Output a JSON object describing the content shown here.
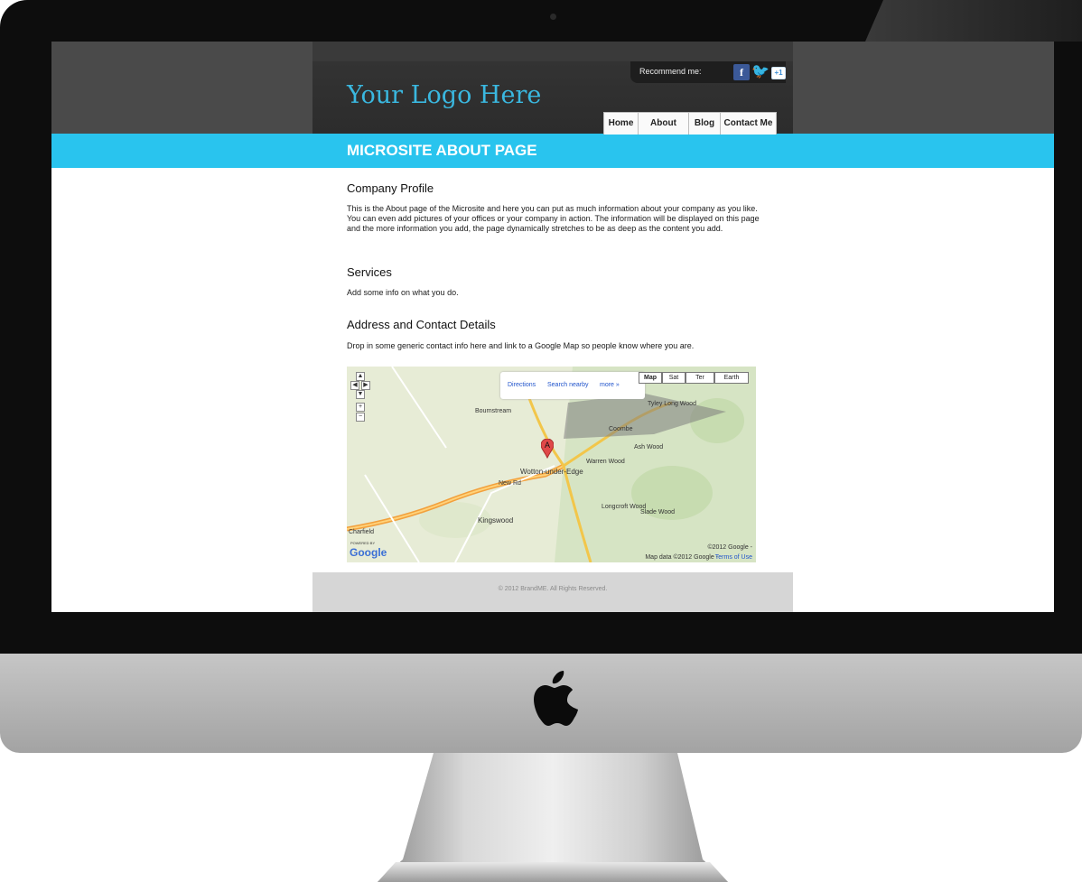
{
  "header": {
    "logo": "Your Logo Here",
    "recommend_label": "Recommend me:",
    "social": {
      "facebook": "f",
      "google_plus": "+1"
    }
  },
  "nav": {
    "items": [
      "Home",
      "About",
      "Blog",
      "Contact Me"
    ]
  },
  "page": {
    "title": "MICROSITE ABOUT PAGE"
  },
  "sections": [
    {
      "heading": "Company Profile",
      "body": "This is the About page of the Microsite and here you can put as much information about your company as you like. You can even add pictures of your offices or your company in action. The information will be displayed on this page and the more information you add, the page dynamically stretches to be as deep as the content you add."
    },
    {
      "heading": "Services",
      "body": "Add some info on what you do."
    },
    {
      "heading": "Address and Contact Details",
      "body": "Drop in some generic contact info here and link to a Google Map so people know where you are."
    }
  ],
  "map": {
    "popup_links": [
      "Directions",
      "Search nearby",
      "more »"
    ],
    "types": [
      "Map",
      "Sat",
      "Ter",
      "Earth"
    ],
    "zoom": [
      "+",
      "−"
    ],
    "places": [
      "Bournstream",
      "Wotton-under-Edge",
      "New Rd",
      "Kingswood",
      "Charfield",
      "Coombe",
      "Longcroft Wood",
      "Slade Wood",
      "Tyley Long Wood",
      "Ash Wood",
      "Warren Wood"
    ],
    "marker": "A",
    "attribution": "©2012 Google -",
    "map_data": "Map data ©2012 Google -",
    "terms": "Terms of Use",
    "powered_by": "POWERED BY",
    "google": "Google"
  },
  "footer": {
    "text": "© 2012 BrandME. All Rights Reserved."
  },
  "colors": {
    "accent": "#29c4ee",
    "logo": "#3ab8e0",
    "header_band": "#4a4a4a",
    "footer": "#d6d6d6"
  }
}
